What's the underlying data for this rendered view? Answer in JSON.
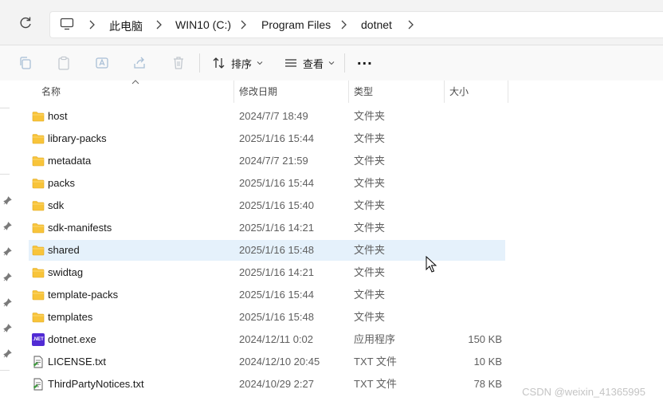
{
  "breadcrumb": {
    "items": [
      "此电脑",
      "WIN10 (C:)",
      "Program Files",
      "dotnet"
    ]
  },
  "toolbar": {
    "sort_label": "排序",
    "view_label": "查看",
    "more_label": "..."
  },
  "columns": {
    "name": "名称",
    "modified": "修改日期",
    "type": "类型",
    "size": "大小"
  },
  "files": [
    {
      "name": "host",
      "modified": "2024/7/7 18:49",
      "type": "文件夹",
      "size": "",
      "icon": "folder-icon"
    },
    {
      "name": "library-packs",
      "modified": "2025/1/16 15:44",
      "type": "文件夹",
      "size": "",
      "icon": "folder-icon"
    },
    {
      "name": "metadata",
      "modified": "2024/7/7 21:59",
      "type": "文件夹",
      "size": "",
      "icon": "folder-icon"
    },
    {
      "name": "packs",
      "modified": "2025/1/16 15:44",
      "type": "文件夹",
      "size": "",
      "icon": "folder-icon"
    },
    {
      "name": "sdk",
      "modified": "2025/1/16 15:40",
      "type": "文件夹",
      "size": "",
      "icon": "folder-icon"
    },
    {
      "name": "sdk-manifests",
      "modified": "2025/1/16 14:21",
      "type": "文件夹",
      "size": "",
      "icon": "folder-icon"
    },
    {
      "name": "shared",
      "modified": "2025/1/16 15:48",
      "type": "文件夹",
      "size": "",
      "icon": "folder-icon",
      "selected": true
    },
    {
      "name": "swidtag",
      "modified": "2025/1/16 14:21",
      "type": "文件夹",
      "size": "",
      "icon": "folder-icon"
    },
    {
      "name": "template-packs",
      "modified": "2025/1/16 15:44",
      "type": "文件夹",
      "size": "",
      "icon": "folder-icon"
    },
    {
      "name": "templates",
      "modified": "2025/1/16 15:48",
      "type": "文件夹",
      "size": "",
      "icon": "folder-icon"
    },
    {
      "name": "dotnet.exe",
      "modified": "2024/12/11 0:02",
      "type": "应用程序",
      "size": "150 KB",
      "icon": "dotnet-exe-icon"
    },
    {
      "name": "LICENSE.txt",
      "modified": "2024/12/10 20:45",
      "type": "TXT 文件",
      "size": "10 KB",
      "icon": "text-file-icon"
    },
    {
      "name": "ThirdPartyNotices.txt",
      "modified": "2024/10/29 2:27",
      "type": "TXT 文件",
      "size": "78 KB",
      "icon": "text-file-icon"
    }
  ],
  "exe_badge": ".NET",
  "watermark": "CSDN @weixin_41365995",
  "colors": {
    "selection": "#e5f1fb",
    "folder": "#f8c43a",
    "dotnet": "#512bd4"
  }
}
